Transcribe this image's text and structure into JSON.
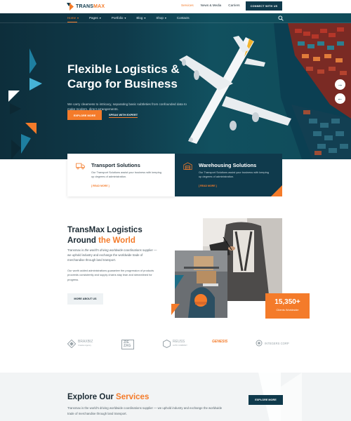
{
  "brand": {
    "name_part1": "TRANS",
    "name_part2": "MAX"
  },
  "topbar": {
    "links": [
      "Services",
      "News & Media",
      "Carriers"
    ],
    "cta_label": "CONNECT WITH US"
  },
  "nav": {
    "items": [
      "Home",
      "Pages",
      "Portfolio",
      "Blog",
      "Shop",
      "Contacts"
    ]
  },
  "hero": {
    "title": "Flexible Logistics & Cargo for Business",
    "description": "We carry clearness to intricacy, separating basic subtleties from confounded data to make modern, direct arrangements.",
    "primary_button": "EXPLORE MORE",
    "secondary_button": "SPEAK WITH EXPERT"
  },
  "services": [
    {
      "title": "Transport Solutions",
      "text": "Our Transport Solutions assist your business with keeping up degrees of administration.",
      "link": "READ MORE",
      "icon": "truck-icon"
    },
    {
      "title": "Warehousing Solutions",
      "text": "Our Transport Solutions assist your business with keeping up degrees of administration.",
      "link": "READ MORE",
      "icon": "warehouse-icon"
    }
  ],
  "about": {
    "title_line1": "TransMax Logistics",
    "title_line2_plain": "Around",
    "title_line2_highlight": "the World",
    "p1_pre": "Transmax is ",
    "p1_italic": "the world's driving worldwide coordinations",
    "p1_post": " supplier — we uphold industry and exchange the worldwide trade of merchandise through land transport.",
    "p2": "Our worth added administrations guarantee the progression of products proceeds consistently and supply chains stay lean and streamlined for progress.",
    "button": "MORE ABOUT US",
    "stat_number": "15,350+",
    "stat_label": "Clients Worldwide"
  },
  "brands": [
    {
      "name": "BRAXBIZ",
      "sub": "Creative Agency",
      "icon": "diamond-icon"
    },
    {
      "name": "ZIE ZAG",
      "sub": "",
      "icon": "boxed-text-icon"
    },
    {
      "name": "REUSS",
      "sub": "AUTO COMPANY",
      "icon": "hexagon-icon"
    },
    {
      "name": "GENESIS",
      "sub": "",
      "icon": "wordmark-icon"
    },
    {
      "name": "INTEGERS CORP",
      "sub": "",
      "icon": "circle-icon"
    }
  ],
  "explore": {
    "title_plain": "Explore Our",
    "title_highlight": "Services",
    "description": "Transmax is the world's driving worldwide coordinations supplier — we uphold industry and exchange the worldwide trade of merchandise through land transport.",
    "button": "EXPLORE MORE"
  },
  "colors": {
    "primary": "#0f3a4c",
    "accent": "#f47b2a",
    "light_bg": "#f2f4f5"
  }
}
